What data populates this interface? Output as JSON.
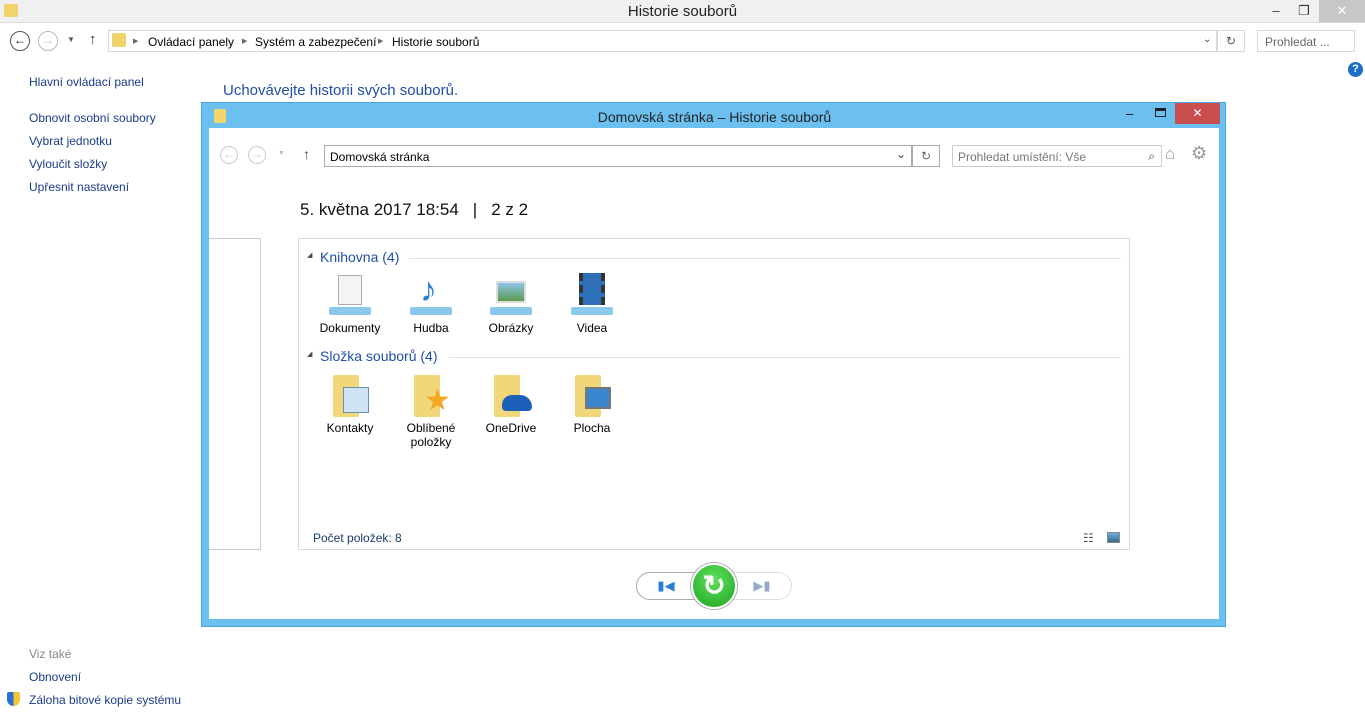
{
  "window": {
    "title": "Historie souborů",
    "minimize": "–",
    "maximize": "❐",
    "close": "✕"
  },
  "address": {
    "crumbs": [
      "Ovládací panely",
      "Systém a zabezpečení",
      "Historie souborů"
    ],
    "search_placeholder": "Prohledat ..."
  },
  "sidebar": {
    "items": [
      "Hlavní ovládací panel",
      "Obnovit osobní soubory",
      "Vybrat jednotku",
      "Vyloučit složky",
      "Upřesnit nastavení"
    ],
    "see_also_label": "Viz také",
    "see_also": [
      "Obnovení",
      "Záloha bitové kopie systému"
    ]
  },
  "main": {
    "heading": "Uchovávejte historii svých souborů.",
    "help": "?"
  },
  "inner": {
    "title": "Domovská stránka – Historie souborů",
    "address": "Domovská stránka",
    "search_placeholder": "Prohledat umístění: Vše",
    "date": "5. května 2017 18:54",
    "separator": "|",
    "page": "2 z 2",
    "groups": [
      {
        "label": "Knihovna (4)",
        "items": [
          "Dokumenty",
          "Hudba",
          "Obrázky",
          "Videa"
        ]
      },
      {
        "label": "Složka souborů (4)",
        "items": [
          "Kontakty",
          "Oblíbené položky",
          "OneDrive",
          "Plocha"
        ]
      }
    ],
    "status": "Počet položek: 8"
  },
  "colors": {
    "accent": "#6bc0ef",
    "close": "#c94f4f",
    "restore": "#2db52d",
    "link": "#1a3a8a"
  }
}
